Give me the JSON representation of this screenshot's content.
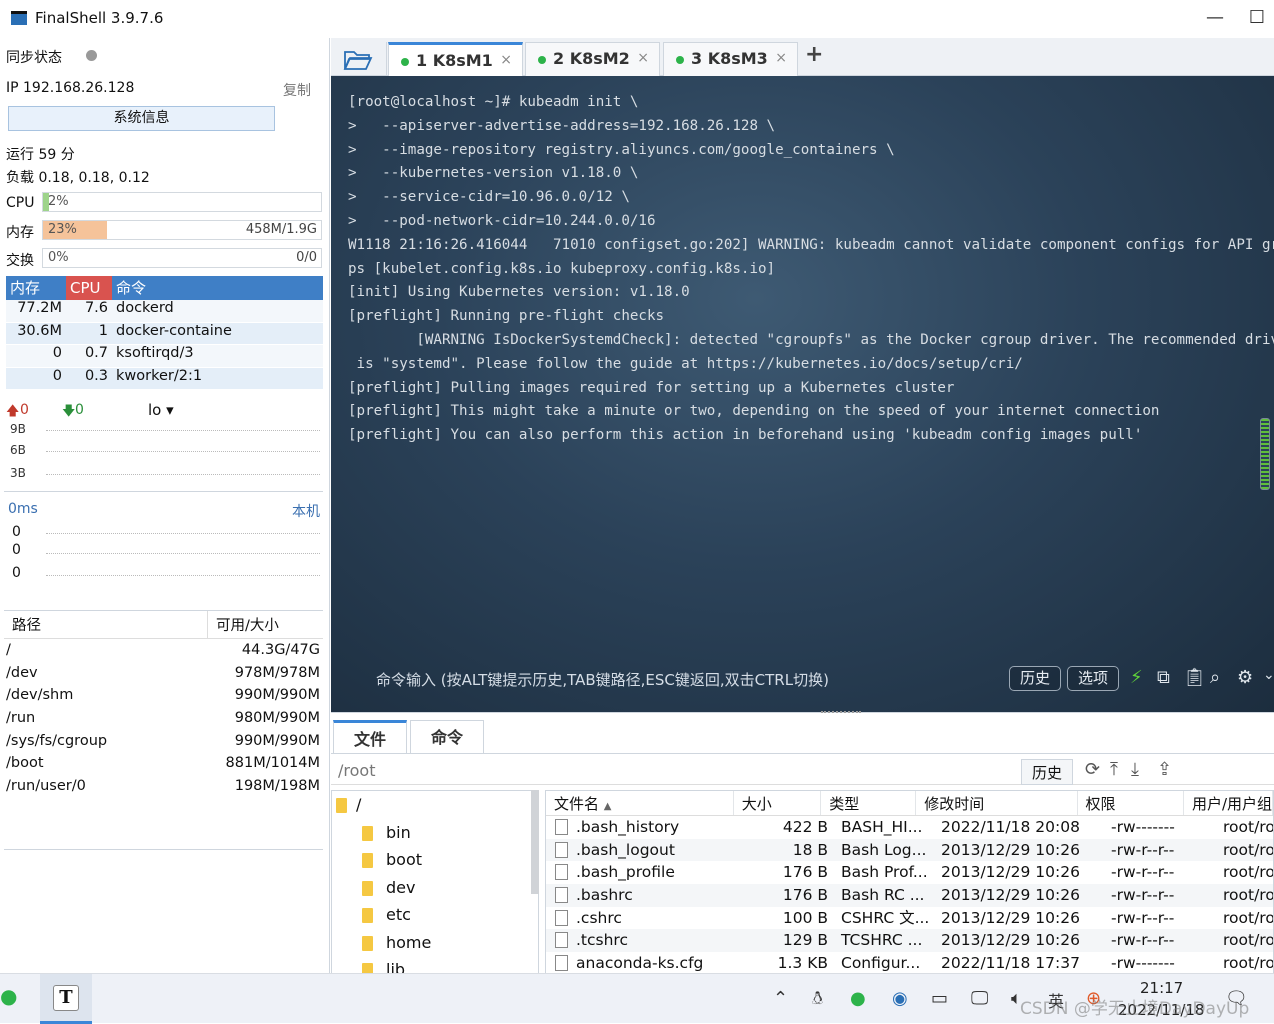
{
  "window": {
    "title": "FinalShell 3.9.7.6",
    "minimize": "—",
    "maximize": "☐"
  },
  "left": {
    "sync_label": "同步状态",
    "ip_label": "IP 192.168.26.128",
    "copy_label": "复制",
    "sysinfo_button": "系统信息",
    "uptime": "运行 59 分",
    "load": "负载 0.18, 0.18, 0.12",
    "cpu": {
      "label": "CPU",
      "percent": "2%",
      "fraction": 0.02
    },
    "mem": {
      "label": "内存",
      "percent": "23%",
      "fraction": 0.23,
      "usage": "458M/1.9G"
    },
    "swap": {
      "label": "交换",
      "percent": "0%",
      "fraction": 0,
      "usage": "0/0"
    },
    "proc_headers": [
      "内存",
      "CPU",
      "命令"
    ],
    "processes": [
      {
        "mem": "77.2M",
        "cpu": "7.6",
        "cmd": "dockerd"
      },
      {
        "mem": "30.6M",
        "cpu": "1",
        "cmd": "docker-containe"
      },
      {
        "mem": "0",
        "cpu": "0.7",
        "cmd": "ksoftirqd/3"
      },
      {
        "mem": "0",
        "cpu": "0.3",
        "cmd": "kworker/2:1"
      }
    ],
    "net": {
      "up": "0",
      "down": "0",
      "iface": "lo",
      "ticks": [
        "9B",
        "6B",
        "3B"
      ]
    },
    "ping": {
      "ms": "0ms",
      "host": "本机",
      "values": [
        "0",
        "0",
        "0"
      ]
    },
    "disk_headers": [
      "路径",
      "可用/大小"
    ],
    "disks": [
      {
        "path": "/",
        "size": "44.3G/47G"
      },
      {
        "path": "/dev",
        "size": "978M/978M"
      },
      {
        "path": "/dev/shm",
        "size": "990M/990M"
      },
      {
        "path": "/run",
        "size": "980M/990M"
      },
      {
        "path": "/sys/fs/cgroup",
        "size": "990M/990M"
      },
      {
        "path": "/boot",
        "size": "881M/1014M"
      },
      {
        "path": "/run/user/0",
        "size": "198M/198M"
      }
    ]
  },
  "tabs": [
    {
      "label": "1  K8sM1",
      "active": true
    },
    {
      "label": "2  K8sM2",
      "active": false
    },
    {
      "label": "3  K8sM3",
      "active": false
    }
  ],
  "tab_close": "×",
  "tab_add": "+",
  "terminal": {
    "lines": [
      "[root@localhost ~]# kubeadm init \\",
      ">   --apiserver-advertise-address=192.168.26.128 \\",
      ">   --image-repository registry.aliyuncs.com/google_containers \\",
      ">   --kubernetes-version v1.18.0 \\",
      ">   --service-cidr=10.96.0.0/12 \\",
      ">   --pod-network-cidr=10.244.0.0/16",
      "W1118 21:16:26.416044   71010 configset.go:202] WARNING: kubeadm cannot validate component configs for API grou",
      "ps [kubelet.config.k8s.io kubeproxy.config.k8s.io]",
      "[init] Using Kubernetes version: v1.18.0",
      "[preflight] Running pre-flight checks",
      "        [WARNING IsDockerSystemdCheck]: detected \"cgroupfs\" as the Docker cgroup driver. The recommended driver",
      " is \"systemd\". Please follow the guide at https://kubernetes.io/docs/setup/cri/",
      "[preflight] Pulling images required for setting up a Kubernetes cluster",
      "[preflight] This might take a minute or two, depending on the speed of your internet connection",
      "[preflight] You can also perform this action in beforehand using 'kubeadm config images pull'"
    ],
    "cmd_input_label": "命令输入 (按ALT键提示历史,TAB键路径,ESC键返回,双击CTRL切换)",
    "history_btn": "历史",
    "options_btn": "选项"
  },
  "files": {
    "tabs": [
      "文件",
      "命令"
    ],
    "path": "/root",
    "history_btn": "历史",
    "tree": [
      "/",
      "bin",
      "boot",
      "dev",
      "etc",
      "home",
      "lib"
    ],
    "headers": [
      "文件名",
      "大小",
      "类型",
      "修改时间",
      "权限",
      "用户/用户组"
    ],
    "rows": [
      {
        "name": ".bash_history",
        "size": "422 B",
        "type": "BASH_HI...",
        "mtime": "2022/11/18 20:08",
        "perm": "-rw-------",
        "owner": "root/root"
      },
      {
        "name": ".bash_logout",
        "size": "18 B",
        "type": "Bash Log...",
        "mtime": "2013/12/29 10:26",
        "perm": "-rw-r--r--",
        "owner": "root/root"
      },
      {
        "name": ".bash_profile",
        "size": "176 B",
        "type": "Bash Prof...",
        "mtime": "2013/12/29 10:26",
        "perm": "-rw-r--r--",
        "owner": "root/root"
      },
      {
        "name": ".bashrc",
        "size": "176 B",
        "type": "Bash RC ...",
        "mtime": "2013/12/29 10:26",
        "perm": "-rw-r--r--",
        "owner": "root/root"
      },
      {
        "name": ".cshrc",
        "size": "100 B",
        "type": "CSHRC 文...",
        "mtime": "2013/12/29 10:26",
        "perm": "-rw-r--r--",
        "owner": "root/root"
      },
      {
        "name": ".tcshrc",
        "size": "129 B",
        "type": "TCSHRC ...",
        "mtime": "2013/12/29 10:26",
        "perm": "-rw-r--r--",
        "owner": "root/root"
      },
      {
        "name": "anaconda-ks.cfg",
        "size": "1.3 KB",
        "type": "Configur...",
        "mtime": "2022/11/18 17:37",
        "perm": "-rw-------",
        "owner": "root/root"
      }
    ]
  },
  "taskbar": {
    "app_letter": "T",
    "time": "21:17",
    "date": "2022/11/18",
    "lang": "英",
    "watermark": "CSDN @学无止境DayDayUp"
  },
  "colors": {
    "accent": "#3a86d8",
    "proc_header": "#3f7fc6",
    "cpu_header": "#d9534f",
    "mem_fill": "#f5c39a",
    "cpu_fill": "#9ed48a",
    "status_green": "#2db34a"
  }
}
